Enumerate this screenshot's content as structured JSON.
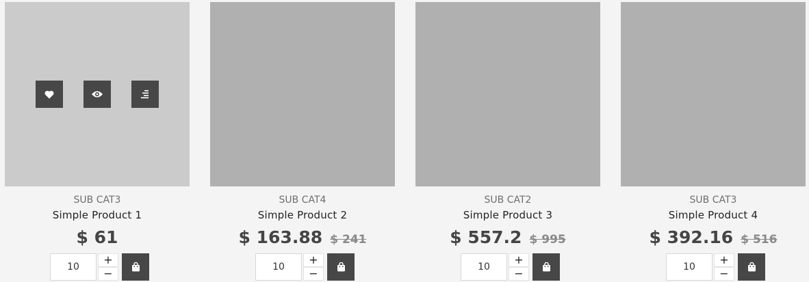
{
  "theme": {
    "accent": "#474747",
    "thumb_default": "#b0b0b0",
    "thumb_hover": "#cbcbcb"
  },
  "products": [
    {
      "category": "SUB CAT3",
      "name": "Simple Product 1",
      "price": "$ 61",
      "old_price": "",
      "quantity": "10",
      "plus_label": "+",
      "minus_label": "−",
      "icons": [
        "heart-icon",
        "eye-icon",
        "list-icon"
      ]
    },
    {
      "category": "SUB CAT4",
      "name": "Simple Product 2",
      "price": "$ 163.88",
      "old_price": "$ 241",
      "quantity": "10",
      "plus_label": "+",
      "minus_label": "−"
    },
    {
      "category": "SUB CAT2",
      "name": "Simple Product 3",
      "price": "$ 557.2",
      "old_price": "$ 995",
      "quantity": "10",
      "plus_label": "+",
      "minus_label": "−"
    },
    {
      "category": "SUB CAT3",
      "name": "Simple Product 4",
      "price": "$ 392.16",
      "old_price": "$ 516",
      "quantity": "10",
      "plus_label": "+",
      "minus_label": "−"
    }
  ]
}
